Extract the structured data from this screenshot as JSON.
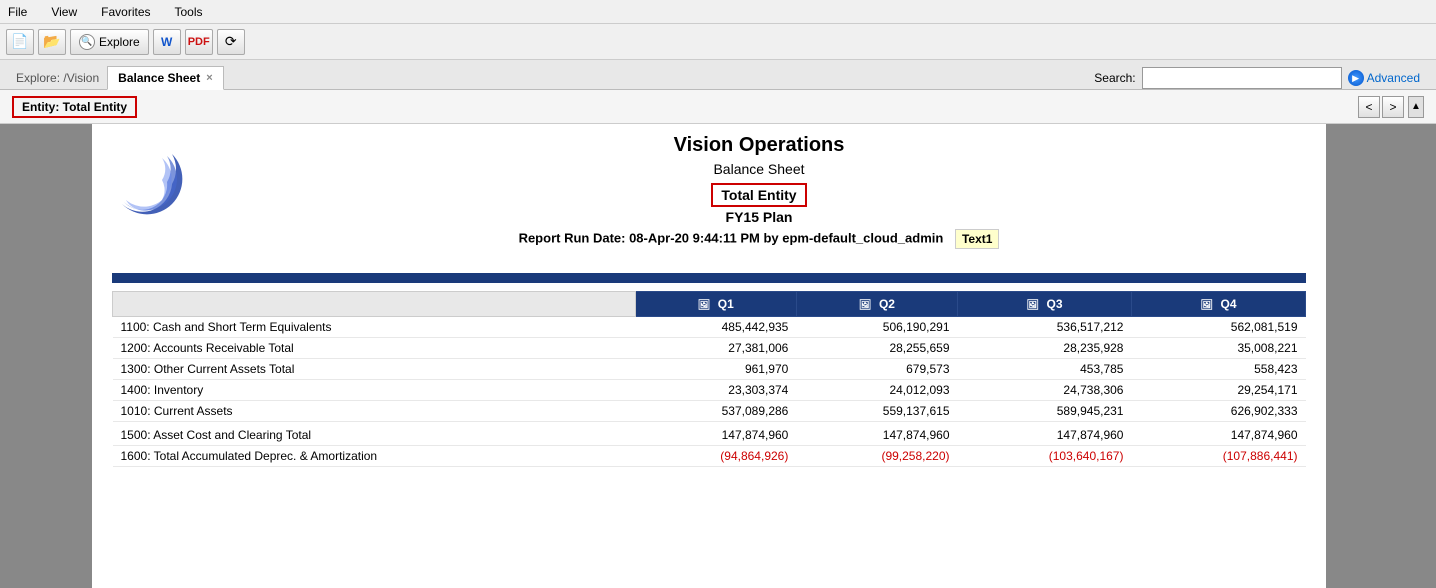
{
  "menubar": {
    "items": [
      "File",
      "View",
      "Favorites",
      "Tools"
    ]
  },
  "toolbar": {
    "explore_label": "Explore",
    "buttons": [
      "new",
      "open",
      "explore",
      "word",
      "pdf",
      "share"
    ]
  },
  "tabs": {
    "explore_label": "Explore: /Vision",
    "active_tab": "Balance Sheet",
    "close_icon": "×"
  },
  "search": {
    "label": "Search:",
    "advanced_label": "Advanced"
  },
  "entity_header": {
    "label": "Entity: Total Entity"
  },
  "report": {
    "company": "Vision Operations",
    "title": "Balance Sheet",
    "entity": "Total Entity",
    "plan": "FY15 Plan",
    "run_date": "Report Run Date: 08-Apr-20 9:44:11 PM by epm-default_cloud_admin",
    "tooltip": "Text1"
  },
  "table": {
    "columns": [
      {
        "label": "",
        "icon": ""
      },
      {
        "label": "Q1",
        "icon": "📷"
      },
      {
        "label": "Q2",
        "icon": "📷"
      },
      {
        "label": "Q3",
        "icon": "📷"
      },
      {
        "label": "Q4",
        "icon": "📷"
      }
    ],
    "rows": [
      {
        "label": "1100: Cash and Short Term Equivalents",
        "q1": "485,442,935",
        "q2": "506,190,291",
        "q3": "536,517,212",
        "q4": "562,081,519",
        "q1_neg": false,
        "q2_neg": false,
        "q3_neg": false,
        "q4_neg": false,
        "separator": false,
        "bold": false
      },
      {
        "label": "1200: Accounts Receivable Total",
        "q1": "27,381,006",
        "q2": "28,255,659",
        "q3": "28,235,928",
        "q4": "35,008,221",
        "q1_neg": false,
        "q2_neg": false,
        "q3_neg": false,
        "q4_neg": false,
        "separator": false,
        "bold": false
      },
      {
        "label": "1300: Other Current Assets Total",
        "q1": "961,970",
        "q2": "679,573",
        "q3": "453,785",
        "q4": "558,423",
        "q1_neg": false,
        "q2_neg": false,
        "q3_neg": false,
        "q4_neg": false,
        "separator": false,
        "bold": false
      },
      {
        "label": "1400: Inventory",
        "q1": "23,303,374",
        "q2": "24,012,093",
        "q3": "24,738,306",
        "q4": "29,254,171",
        "q1_neg": false,
        "q2_neg": false,
        "q3_neg": false,
        "q4_neg": false,
        "separator": false,
        "bold": false
      },
      {
        "label": "1010: Current Assets",
        "q1": "537,089,286",
        "q2": "559,137,615",
        "q3": "589,945,231",
        "q4": "626,902,333",
        "q1_neg": false,
        "q2_neg": false,
        "q3_neg": false,
        "q4_neg": false,
        "separator": false,
        "bold": false
      },
      {
        "label": "1500: Asset Cost and Clearing Total",
        "q1": "147,874,960",
        "q2": "147,874,960",
        "q3": "147,874,960",
        "q4": "147,874,960",
        "q1_neg": false,
        "q2_neg": false,
        "q3_neg": false,
        "q4_neg": false,
        "separator": true,
        "bold": false
      },
      {
        "label": "1600: Total Accumulated Deprec. & Amortization",
        "q1": "(94,864,926)",
        "q2": "(99,258,220)",
        "q3": "(103,640,167)",
        "q4": "(107,886,441)",
        "q1_neg": true,
        "q2_neg": true,
        "q3_neg": true,
        "q4_neg": true,
        "separator": false,
        "bold": false
      }
    ]
  }
}
